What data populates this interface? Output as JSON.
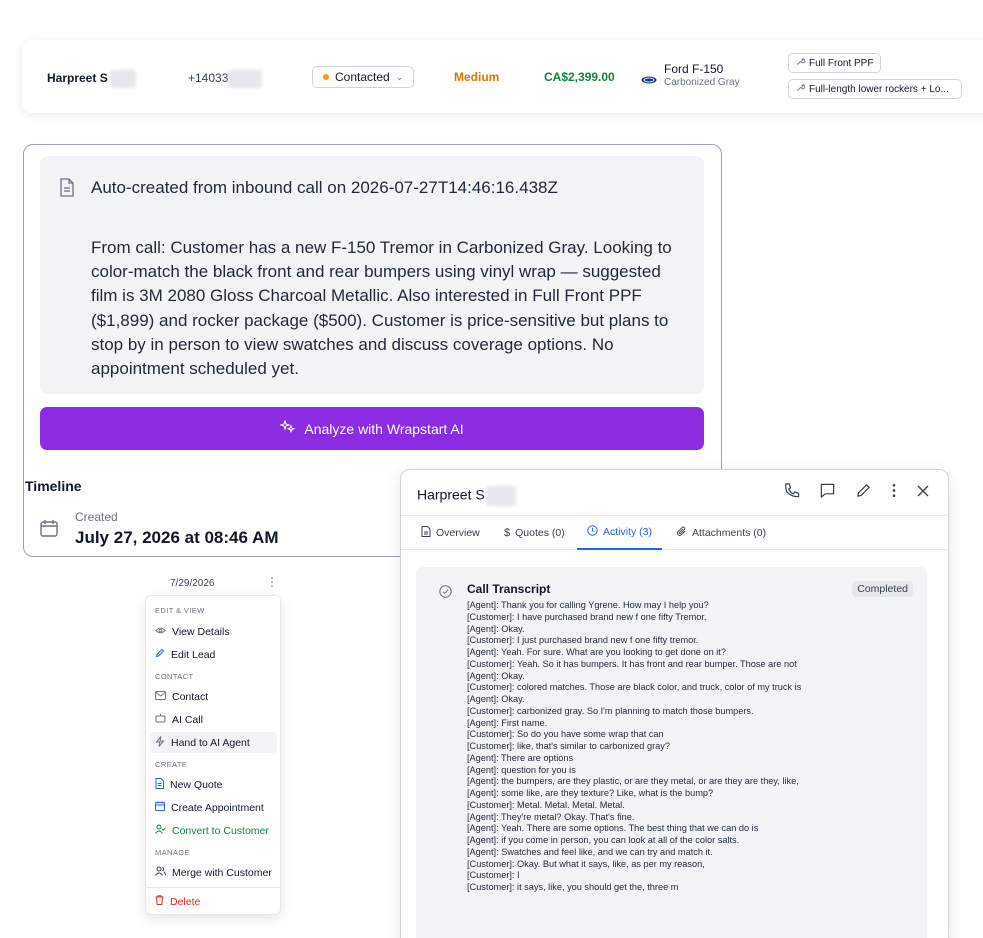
{
  "lead_row": {
    "name": "Harpreet S",
    "phone": "+14033",
    "status": "Contacted",
    "priority": "Medium",
    "price": "CA$2,399.00",
    "vehicle_model": "Ford F-150",
    "vehicle_color": "Carbonized Gray",
    "services": [
      "Full Front PPF",
      "Full-length lower rockers + Lo..."
    ],
    "colors": {
      "status_dot": "#f59e0b",
      "priority": "#d97706",
      "price": "#15803d"
    }
  },
  "notes": {
    "title": "Auto-created from inbound call on 2026-07-27T14:46:16.438Z",
    "body": "From call: Customer has a new F-150 Tremor in Carbonized Gray. Looking to color-match the black front and rear bumpers using vinyl wrap — suggested film is 3M 2080 Gloss Charcoal Metallic. Also interested in Full Front PPF ($1,899) and rocker package ($500). Customer is price-sensitive but plans to stop by in person to view swatches and discuss coverage options. No appointment scheduled yet.",
    "ai_button": "Analyze with Wrapstart AI",
    "accent": "#8b2be2"
  },
  "timeline": {
    "heading": "Timeline",
    "created_label": "Created",
    "created_date": "July 27, 2026 at 08:46 AM"
  },
  "menu": {
    "date": "7/29/2026",
    "sections": {
      "edit_view": "EDIT & VIEW",
      "contact": "CONTACT",
      "create": "CREATE",
      "manage": "MANAGE"
    },
    "items": {
      "view_details": "View Details",
      "edit_lead": "Edit Lead",
      "contact": "Contact",
      "ai_call": "AI Call",
      "hand_to_agent": "Hand to AI Agent",
      "new_quote": "New Quote",
      "create_appointment": "Create Appointment",
      "convert": "Convert to Customer",
      "merge": "Merge with Customer",
      "delete": "Delete"
    }
  },
  "panel": {
    "name": "Harpreet S",
    "tabs": {
      "overview": "Overview",
      "quotes": "Quotes (0)",
      "activity": "Activity (3)",
      "attachments": "Attachments (0)"
    },
    "transcript": {
      "title": "Call Transcript",
      "status": "Completed",
      "lines": [
        "[Agent]: Thank you for calling Ygrene. How may I help you?",
        "[Customer]: I have purchased brand new f one fifty Tremor.",
        "[Agent]: Okay.",
        "[Customer]: I just purchased brand new f one fifty tremor.",
        "[Agent]: Yeah. For sure. What are you looking to get done on it?",
        "[Customer]: Yeah. So it has bumpers. It has front and rear bumper. Those are not",
        "[Agent]: Okay.",
        "[Customer]: colored matches. Those are black color, and truck, color of my truck is",
        "[Agent]: Okay.",
        "[Customer]: carbonized gray. So I'm planning to match those bumpers.",
        "[Agent]: First name.",
        "[Customer]: So do you have some wrap that can",
        "[Customer]: like, that's similar to carbonized gray?",
        "[Agent]: There are options",
        "[Agent]: question for you is",
        "[Agent]: the bumpers, are they plastic, or are they metal, or are they are they, like,",
        "[Agent]: some like, are they texture? Like, what is the bump?",
        "[Customer]: Metal. Metal. Metal. Metal.",
        "[Agent]: They're metal? Okay. That's fine.",
        "[Agent]: Yeah. There are some options. The best thing that we can do is",
        "[Agent]: if you come in person, you can look at all of the color salts.",
        "[Agent]: Swatches and feel like, and we can try and match it.",
        "[Customer]: Okay. But what it says, like, as per my reason,",
        "[Customer]: I",
        "[Customer]: it says, like, you should get the, three m"
      ]
    }
  }
}
